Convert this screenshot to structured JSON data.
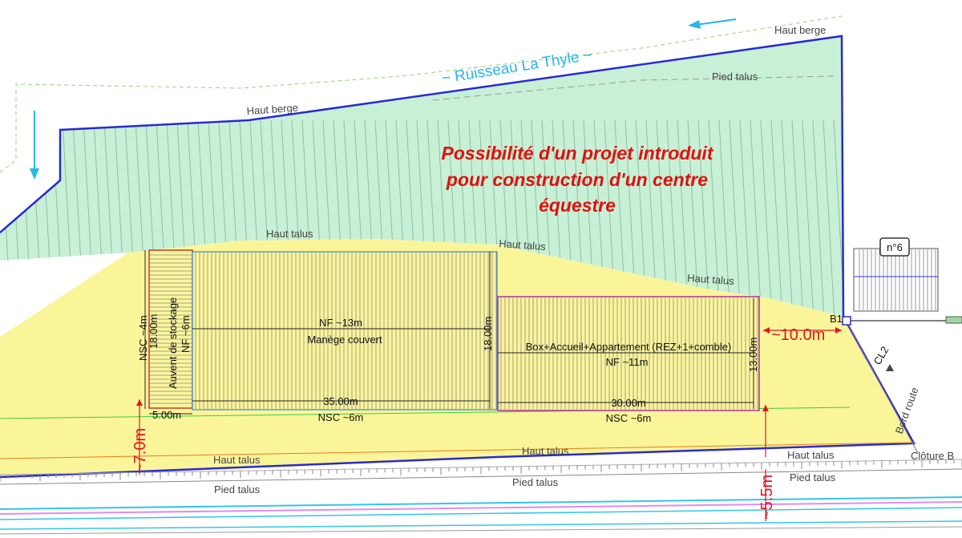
{
  "title": {
    "line1": "Possibilité d'un projet introduit",
    "line2": "pour construction d'un centre",
    "line3": "équestre"
  },
  "stream_label": "~ Ruisseau La Thyle ~",
  "banks": {
    "haut_berge_top": "Haut berge",
    "haut_berge_left": "Haut berge",
    "pied_talus_top": "Pied talus",
    "haut_talus_1": "Haut talus",
    "haut_talus_2": "Haut talus",
    "haut_talus_3": "Haut talus",
    "haut_talus_bottom_left": "Haut talus",
    "haut_talus_bottom_mid": "Haut talus",
    "haut_talus_bottom_right": "Haut talus",
    "pied_talus_bottom_left": "Pied talus",
    "pied_talus_bottom_mid": "Pied talus",
    "pied_talus_bottom_right": "Pied talus",
    "cloture": "Clôture B",
    "bord_route": "Bord route"
  },
  "buildings": {
    "auvent": {
      "name": "Auvent de stockage",
      "nf": "NF ~6m",
      "nsc": "NSC ~4m",
      "depth": "18.00m",
      "width": "5.00m"
    },
    "manege": {
      "nf": "NF ~13m",
      "name": "Manège couvert",
      "depth": "18.00m",
      "width": "35.00m",
      "nsc": "NSC ~6m"
    },
    "box": {
      "name": "Box+Accueil+Appartement (REZ+1+comble)",
      "nf": "NF ~11m",
      "depth": "13.00m",
      "width": "30.00m",
      "nsc": "NSC ~6m"
    }
  },
  "distances": {
    "d1": "~10.0m",
    "d2": "~7.0m",
    "d3": "~5.5m"
  },
  "markers": {
    "parcel": "n°6",
    "b1": "B1",
    "cl2": "CL2"
  },
  "colors": {
    "slope_green": "#c8f0d6",
    "ground_yellow": "#fbf59a",
    "boundary_blue": "#2a2acf",
    "water_cyan": "#27b6e6",
    "accent_red": "#e01010"
  }
}
